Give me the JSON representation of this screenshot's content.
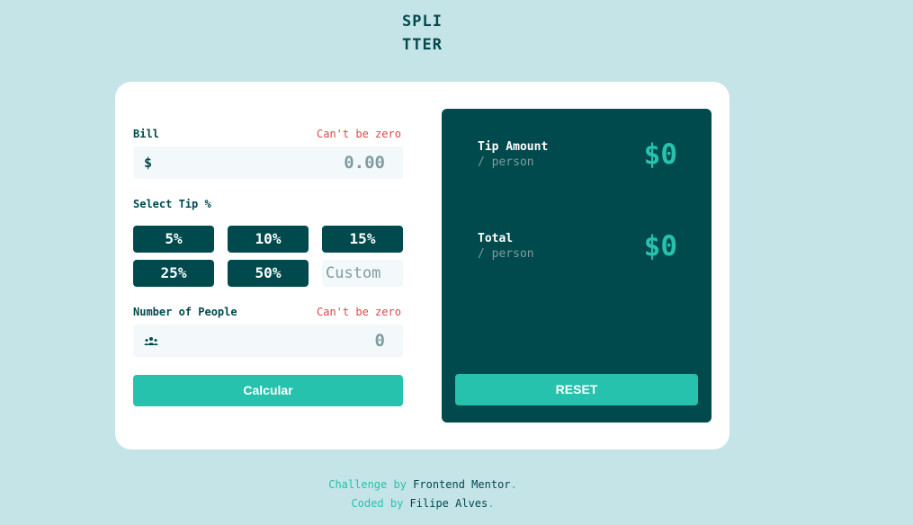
{
  "logo": {
    "line1": "SPLI",
    "line2": "TTER"
  },
  "bill": {
    "label": "Bill",
    "error": "Can't be zero",
    "prefix": "$",
    "value": "0.00"
  },
  "tip": {
    "label": "Select Tip %",
    "options": [
      "5%",
      "10%",
      "15%",
      "25%",
      "50%"
    ],
    "custom_placeholder": "Custom"
  },
  "people": {
    "label": "Number of People",
    "error": "Can't be zero",
    "value": "0"
  },
  "calc_button": "Calcular",
  "result": {
    "tip_title": "Tip Amount",
    "tip_sub": "/ person",
    "tip_value": "$0",
    "total_title": "Total",
    "total_sub": "/ person",
    "total_value": "$0",
    "reset": "RESET"
  },
  "footer": {
    "challenge_prefix": "Challenge by",
    "challenge_by": "Frontend Mentor",
    "challenge_suffix": ".",
    "coded_prefix": "Coded by",
    "coded_by": "Filipe Alves",
    "coded_suffix": "."
  },
  "colors": {
    "background": "#c5e4e7",
    "dark_cyan": "#00494d",
    "accent": "#26c2ad",
    "error": "#e0474c",
    "grayish": "#7f9c9f",
    "input_bg": "#f3f8fb"
  },
  "icons": {
    "bill_prefix": "dollar-icon",
    "people_prefix": "person-icon"
  }
}
